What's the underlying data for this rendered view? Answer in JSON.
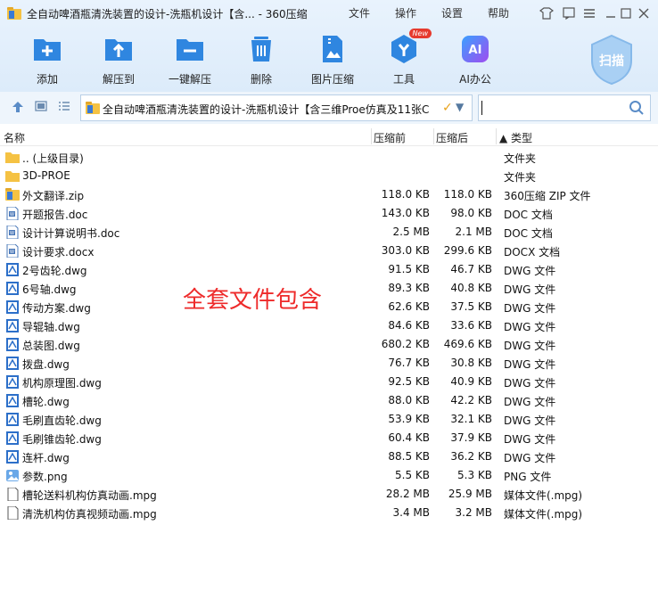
{
  "window": {
    "title": "全自动啤酒瓶清洗装置的设计-洗瓶机设计【含... - 360压缩",
    "menu": [
      "文件",
      "操作",
      "设置",
      "帮助"
    ]
  },
  "toolbar": {
    "items": [
      {
        "label": "添加",
        "icon": "add-icon",
        "color": "#2f86e0"
      },
      {
        "label": "解压到",
        "icon": "extract-to-icon",
        "color": "#2f86e0"
      },
      {
        "label": "一键解压",
        "icon": "one-click-extract-icon",
        "color": "#2f86e0"
      },
      {
        "label": "删除",
        "icon": "delete-icon",
        "color": "#2f86e0"
      },
      {
        "label": "图片压缩",
        "icon": "image-compress-icon",
        "color": "#2f86e0"
      },
      {
        "label": "工具",
        "icon": "tools-icon",
        "color": "#2f86e0",
        "badge": "New"
      },
      {
        "label": "AI办公",
        "icon": "ai-office-icon",
        "color": "#8a4cf0"
      }
    ],
    "scan_label": "扫描"
  },
  "address": {
    "path": "全自动啤酒瓶清洗装置的设计-洗瓶机设计【含三维Proe仿真及11张C",
    "search_placeholder": ""
  },
  "columns": {
    "name": "名称",
    "compressed": "压缩前",
    "uncompressed": "压缩后",
    "type": "▲ 类型"
  },
  "files": [
    {
      "name": ".. (上级目录)",
      "before": "",
      "after": "",
      "type": "文件夹",
      "icon": "folder-up"
    },
    {
      "name": "3D-PROE",
      "before": "",
      "after": "",
      "type": "文件夹",
      "icon": "folder"
    },
    {
      "name": "外文翻译.zip",
      "before": "118.0 KB",
      "after": "118.0 KB",
      "type": "360压缩 ZIP 文件",
      "icon": "zip"
    },
    {
      "name": "开题报告.doc",
      "before": "143.0 KB",
      "after": "98.0 KB",
      "type": "DOC 文档",
      "icon": "doc"
    },
    {
      "name": "设计计算说明书.doc",
      "before": "2.5 MB",
      "after": "2.1 MB",
      "type": "DOC 文档",
      "icon": "doc"
    },
    {
      "name": "设计要求.docx",
      "before": "303.0 KB",
      "after": "299.6 KB",
      "type": "DOCX 文档",
      "icon": "doc"
    },
    {
      "name": "2号齿轮.dwg",
      "before": "91.5 KB",
      "after": "46.7 KB",
      "type": "DWG 文件",
      "icon": "dwg"
    },
    {
      "name": "6号轴.dwg",
      "before": "89.3 KB",
      "after": "40.8 KB",
      "type": "DWG 文件",
      "icon": "dwg"
    },
    {
      "name": "传动方案.dwg",
      "before": "62.6 KB",
      "after": "37.5 KB",
      "type": "DWG 文件",
      "icon": "dwg"
    },
    {
      "name": "导辊轴.dwg",
      "before": "84.6 KB",
      "after": "33.6 KB",
      "type": "DWG 文件",
      "icon": "dwg"
    },
    {
      "name": "总装图.dwg",
      "before": "680.2 KB",
      "after": "469.6 KB",
      "type": "DWG 文件",
      "icon": "dwg"
    },
    {
      "name": "拨盘.dwg",
      "before": "76.7 KB",
      "after": "30.8 KB",
      "type": "DWG 文件",
      "icon": "dwg"
    },
    {
      "name": "机构原理图.dwg",
      "before": "92.5 KB",
      "after": "40.9 KB",
      "type": "DWG 文件",
      "icon": "dwg"
    },
    {
      "name": "槽轮.dwg",
      "before": "88.0 KB",
      "after": "42.2 KB",
      "type": "DWG 文件",
      "icon": "dwg"
    },
    {
      "name": "毛刷直齿轮.dwg",
      "before": "53.9 KB",
      "after": "32.1 KB",
      "type": "DWG 文件",
      "icon": "dwg"
    },
    {
      "name": "毛刷锥齿轮.dwg",
      "before": "60.4 KB",
      "after": "37.9 KB",
      "type": "DWG 文件",
      "icon": "dwg"
    },
    {
      "name": "连杆.dwg",
      "before": "88.5 KB",
      "after": "36.2 KB",
      "type": "DWG 文件",
      "icon": "dwg"
    },
    {
      "name": "参数.png",
      "before": "5.5 KB",
      "after": "5.3 KB",
      "type": "PNG 文件",
      "icon": "png"
    },
    {
      "name": "槽轮送料机构仿真动画.mpg",
      "before": "28.2 MB",
      "after": "25.9 MB",
      "type": "媒体文件(.mpg)",
      "icon": "mpg"
    },
    {
      "name": "清洗机构仿真视频动画.mpg",
      "before": "3.4 MB",
      "after": "3.2 MB",
      "type": "媒体文件(.mpg)",
      "icon": "mpg"
    }
  ],
  "overlay_text": "全套文件包含",
  "colors": {
    "accent": "#2f86e0",
    "watermark": "#ee2a2a",
    "folder": "#f5c243"
  }
}
